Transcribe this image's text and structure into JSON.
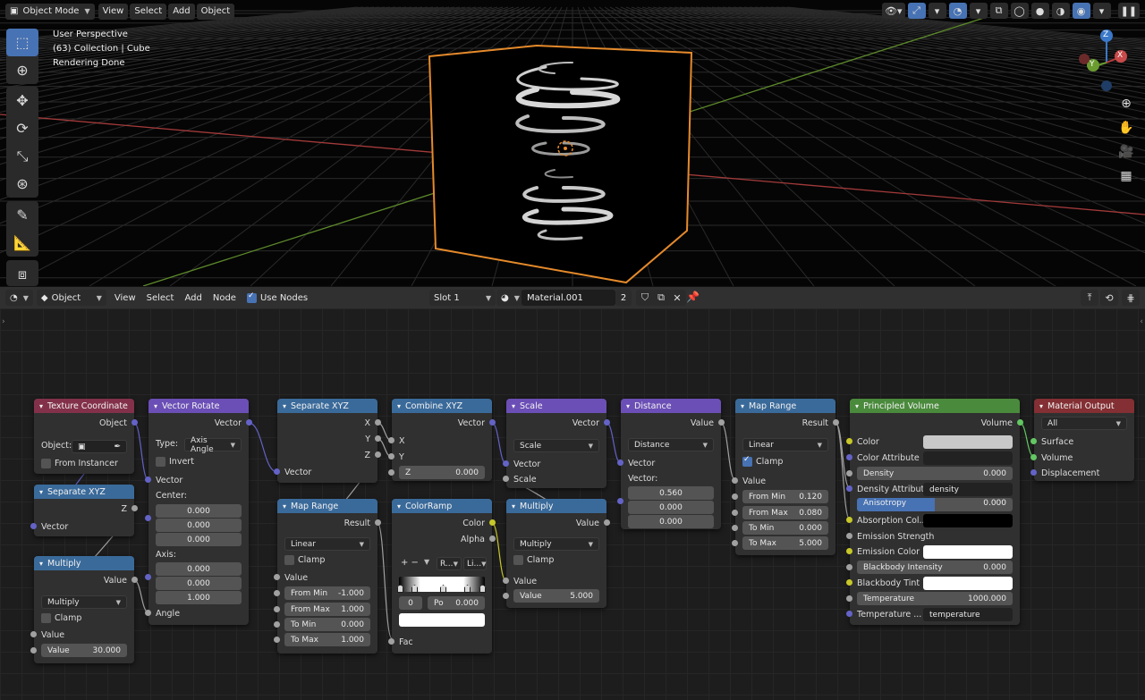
{
  "viewport": {
    "header": {
      "mode_label": "Object Mode",
      "menus": [
        "View",
        "Select",
        "Add",
        "Object"
      ]
    },
    "info": {
      "perspective": "User Perspective",
      "collection": "(63) Collection | Cube",
      "status": "Rendering Done"
    },
    "gizmo_axes": {
      "z": "Z",
      "y": "Y",
      "x": "X"
    },
    "colors": {
      "selection_outline": "#e58a2b",
      "x_axis_line": "#a33a3a",
      "y_axis_line": "#5d8a2b",
      "accent": "#4772b3"
    }
  },
  "node_header": {
    "object_label": "Object",
    "menus": [
      "View",
      "Select",
      "Add",
      "Node"
    ],
    "use_nodes_label": "Use Nodes",
    "use_nodes_checked": true,
    "slot_label": "Slot 1",
    "material_name": "Material.001",
    "user_count": "2"
  },
  "nodes": {
    "texcoord": {
      "title": "Texture Coordinate",
      "out_object": "Object",
      "object_label": "Object:",
      "from_instancer": "From Instancer"
    },
    "sepxyz1": {
      "title": "Separate XYZ",
      "out_z": "Z",
      "in_vector": "Vector"
    },
    "multiply1": {
      "title": "Multiply",
      "out_value": "Value",
      "op": "Multiply",
      "clamp": "Clamp",
      "in_value": "Value",
      "value_label": "Value",
      "value": "30.000"
    },
    "vrotate": {
      "title": "Vector Rotate",
      "out_vector": "Vector",
      "type_label": "Type:",
      "type": "Axis Angle",
      "invert": "Invert",
      "in_vector": "Vector",
      "center_label": "Center:",
      "center": [
        "0.000",
        "0.000",
        "0.000"
      ],
      "axis_label": "Axis:",
      "axis": [
        "0.000",
        "0.000",
        "1.000"
      ],
      "in_angle": "Angle"
    },
    "sepxyz2": {
      "title": "Separate XYZ",
      "out_x": "X",
      "out_y": "Y",
      "out_z": "Z",
      "in_vector": "Vector"
    },
    "maprange1": {
      "title": "Map Range",
      "out_result": "Result",
      "interp": "Linear",
      "clamp": "Clamp",
      "in_value": "Value",
      "fields": [
        {
          "label": "From Min",
          "value": "-1.000"
        },
        {
          "label": "From Max",
          "value": "1.000"
        },
        {
          "label": "To Min",
          "value": "0.000"
        },
        {
          "label": "To Max",
          "value": "1.000"
        }
      ]
    },
    "combxyz": {
      "title": "Combine XYZ",
      "out_vector": "Vector",
      "in_x": "X",
      "in_y": "Y",
      "z_label": "Z",
      "z_value": "0.000"
    },
    "colorramp": {
      "title": "ColorRamp",
      "out_color": "Color",
      "out_alpha": "Alpha",
      "add_remove": "+ −",
      "color_mode": "R...",
      "interp": "Li...",
      "index": "0",
      "pos_label": "Po",
      "pos_value": "0.000",
      "in_fac": "Fac"
    },
    "scale": {
      "title": "Scale",
      "out_vector": "Vector",
      "op": "Scale",
      "in_vector": "Vector",
      "in_scale": "Scale"
    },
    "multiply2": {
      "title": "Multiply",
      "out_value": "Value",
      "op": "Multiply",
      "clamp": "Clamp",
      "in_value": "Value",
      "value_label": "Value",
      "value": "5.000"
    },
    "distance": {
      "title": "Distance",
      "out_value": "Value",
      "op": "Distance",
      "in_vector": "Vector",
      "vector_label": "Vector:",
      "vector": [
        "0.560",
        "0.000",
        "0.000"
      ]
    },
    "maprange2": {
      "title": "Map Range",
      "out_result": "Result",
      "interp": "Linear",
      "clamp": "Clamp",
      "in_value": "Value",
      "fields": [
        {
          "label": "From Min",
          "value": "0.120"
        },
        {
          "label": "From Max",
          "value": "0.080"
        },
        {
          "label": "To Min",
          "value": "0.000"
        },
        {
          "label": "To Max",
          "value": "5.000"
        }
      ]
    },
    "pvolume": {
      "title": "Principled Volume",
      "out_volume": "Volume",
      "color": "Color",
      "color_attr": "Color Attribute",
      "density_label": "Density",
      "density_value": "0.000",
      "density_attr": "Density Attribut",
      "density_attr_value": "density",
      "anisotropy_label": "Anisotropy",
      "anisotropy_value": "0.000",
      "anisotropy_fill": 0.5,
      "absorption": "Absorption Col...",
      "emission_strength": "Emission Strength",
      "emission_color": "Emission Color",
      "bb_intensity_label": "Blackbody Intensity",
      "bb_intensity_value": "0.000",
      "bb_tint": "Blackbody Tint",
      "temperature_label": "Temperature",
      "temperature_value": "1000.000",
      "temp_attr": "Temperature ...",
      "temp_attr_value": "temperature"
    },
    "matout": {
      "title": "Material Output",
      "target": "All",
      "in_surface": "Surface",
      "in_volume": "Volume",
      "in_displacement": "Displacement"
    }
  }
}
